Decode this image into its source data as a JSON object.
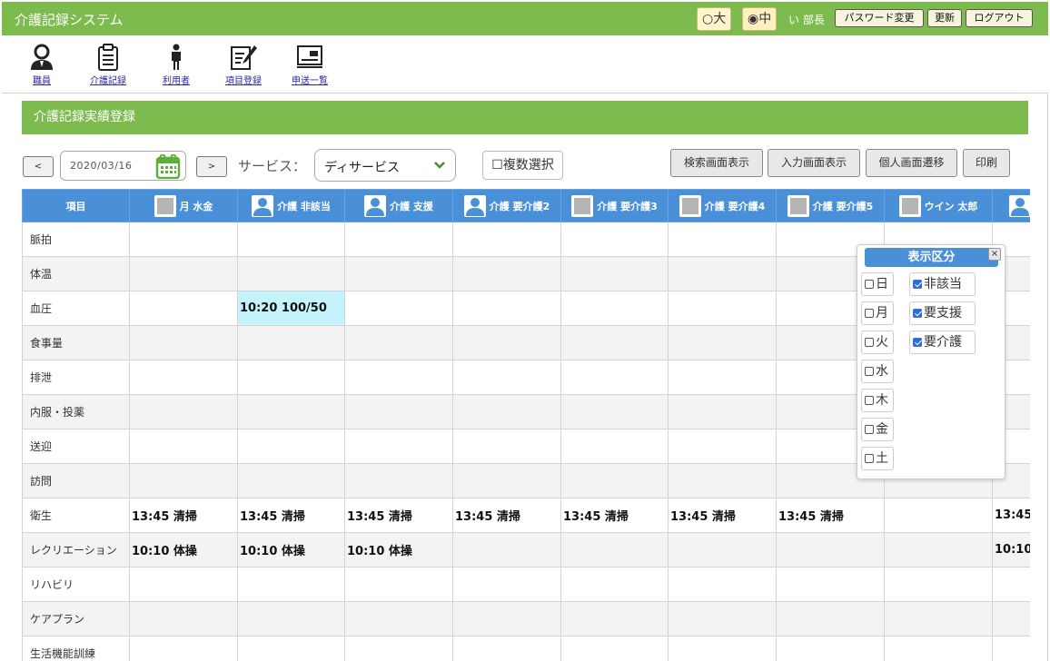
{
  "header": {
    "app_title": "介護記録システム",
    "size_large": "○大",
    "size_medium": "◉中",
    "user_name": "い 部長",
    "password_change": "パスワード変更",
    "refresh": "更新",
    "logout": "ログアウト",
    "accent_color": "#7dbb4e"
  },
  "nav": [
    {
      "label": "職員",
      "icon": "staff-person-icon"
    },
    {
      "label": "介護記録",
      "icon": "clipboard-icon"
    },
    {
      "label": "利用者",
      "icon": "user-standing-icon"
    },
    {
      "label": "項目登録",
      "icon": "edit-note-icon"
    },
    {
      "label": "申送一覧",
      "icon": "handover-board-icon"
    }
  ],
  "section_title": "介護記録実績登録",
  "toolbar": {
    "prev": "<",
    "next": ">",
    "date": "2020/03/16",
    "service_label": "サービス：",
    "service_value": "ディサービス",
    "multi_select": "☐複数選択",
    "search_view": "検索画面表示",
    "input_view": "入力画面表示",
    "personal_view": "個人画面遷移",
    "print": "印刷"
  },
  "grid": {
    "item_header": "項目",
    "header_color": "#4a90d9",
    "columns": [
      {
        "name": "月 水金",
        "avatar": "no-image"
      },
      {
        "name": "介護 非該当",
        "avatar": "person"
      },
      {
        "name": "介護 支援",
        "avatar": "person"
      },
      {
        "name": "介護 要介護2",
        "avatar": "person"
      },
      {
        "name": "介護 要介護3",
        "avatar": "no-image"
      },
      {
        "name": "介護 要介護4",
        "avatar": "no-image"
      },
      {
        "name": "介護 要介護5",
        "avatar": "no-image"
      },
      {
        "name": "ウイン 太郎",
        "avatar": "no-image"
      },
      {
        "name": "",
        "avatar": "person"
      }
    ],
    "rows": [
      {
        "label": "脈拍",
        "cells": [
          "",
          "",
          "",
          "",
          "",
          "",
          "",
          "",
          ""
        ]
      },
      {
        "label": "体温",
        "cells": [
          "",
          "",
          "",
          "",
          "",
          "",
          "",
          "",
          ""
        ]
      },
      {
        "label": "血圧",
        "cells": [
          "",
          "10:20 100/50",
          "",
          "",
          "",
          "",
          "",
          "",
          ""
        ]
      },
      {
        "label": "食事量",
        "cells": [
          "",
          "",
          "",
          "",
          "",
          "",
          "",
          "",
          ""
        ]
      },
      {
        "label": "排泄",
        "cells": [
          "",
          "",
          "",
          "",
          "",
          "",
          "",
          "",
          ""
        ]
      },
      {
        "label": "内服・投薬",
        "cells": [
          "",
          "",
          "",
          "",
          "",
          "",
          "",
          "",
          ""
        ]
      },
      {
        "label": "送迎",
        "cells": [
          "",
          "",
          "",
          "",
          "",
          "",
          "",
          "",
          ""
        ]
      },
      {
        "label": "訪問",
        "cells": [
          "",
          "",
          "",
          "",
          "",
          "",
          "",
          "",
          ""
        ]
      },
      {
        "label": "衛生",
        "cells": [
          "13:45 清掃",
          "13:45 清掃",
          "13:45 清掃",
          "13:45 清掃",
          "13:45 清掃",
          "13:45 清掃",
          "13:45 清掃",
          "",
          "13:45"
        ]
      },
      {
        "label": "レクリエーション",
        "cells": [
          "10:10 体操",
          "10:10 体操",
          "10:10 体操",
          "",
          "",
          "",
          "",
          "",
          "10:10"
        ]
      },
      {
        "label": "リハビリ",
        "cells": [
          "",
          "",
          "",
          "",
          "",
          "",
          "",
          "",
          ""
        ]
      },
      {
        "label": "ケアプラン",
        "cells": [
          "",
          "",
          "",
          "",
          "",
          "",
          "",
          "",
          ""
        ]
      },
      {
        "label": "生活機能訓練",
        "cells": [
          "",
          "",
          "",
          "",
          "",
          "",
          "",
          "",
          ""
        ]
      }
    ],
    "highlight_color": "#c4f3fb"
  },
  "popup": {
    "title": "表示区分",
    "close": "×",
    "days": [
      {
        "label": "日",
        "checked": false
      },
      {
        "label": "月",
        "checked": false
      },
      {
        "label": "火",
        "checked": false
      },
      {
        "label": "水",
        "checked": false
      },
      {
        "label": "木",
        "checked": false
      },
      {
        "label": "金",
        "checked": false
      },
      {
        "label": "土",
        "checked": false
      }
    ],
    "categories": [
      {
        "label": "非該当",
        "checked": true
      },
      {
        "label": "要支援",
        "checked": true
      },
      {
        "label": "要介護",
        "checked": true
      }
    ]
  }
}
